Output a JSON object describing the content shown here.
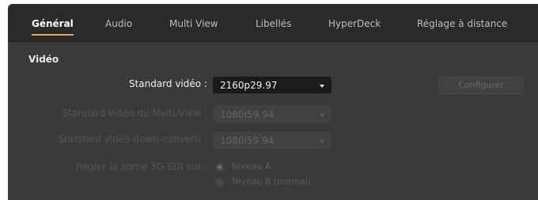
{
  "tabs": [
    {
      "label": "Général",
      "active": true
    },
    {
      "label": "Audio",
      "active": false
    },
    {
      "label": "Multi View",
      "active": false
    },
    {
      "label": "Libellés",
      "active": false
    },
    {
      "label": "HyperDeck",
      "active": false
    },
    {
      "label": "Réglage à distance",
      "active": false
    }
  ],
  "section": {
    "title": "Vidéo"
  },
  "video_standard": {
    "label": "Standard vidéo :",
    "value": "2160p29.97"
  },
  "configure_button": {
    "label": "Configurer"
  },
  "multiview_standard": {
    "label": "Standard vidéo du Multi View :",
    "value": "1080i59.94"
  },
  "downconvert_standard": {
    "label": "Standard vidéo down-converti :",
    "value": "1080i59.94"
  },
  "sdi_3g": {
    "label": "Régler la sortie 3G SDI sur :",
    "options": [
      {
        "label": "Niveau A",
        "selected": true
      },
      {
        "label": "Niveau B (normal)",
        "selected": false
      }
    ]
  },
  "colors": {
    "accent": "#f0a43a",
    "panel": "#3a3a3a",
    "tabbar": "#2a2a2a"
  }
}
